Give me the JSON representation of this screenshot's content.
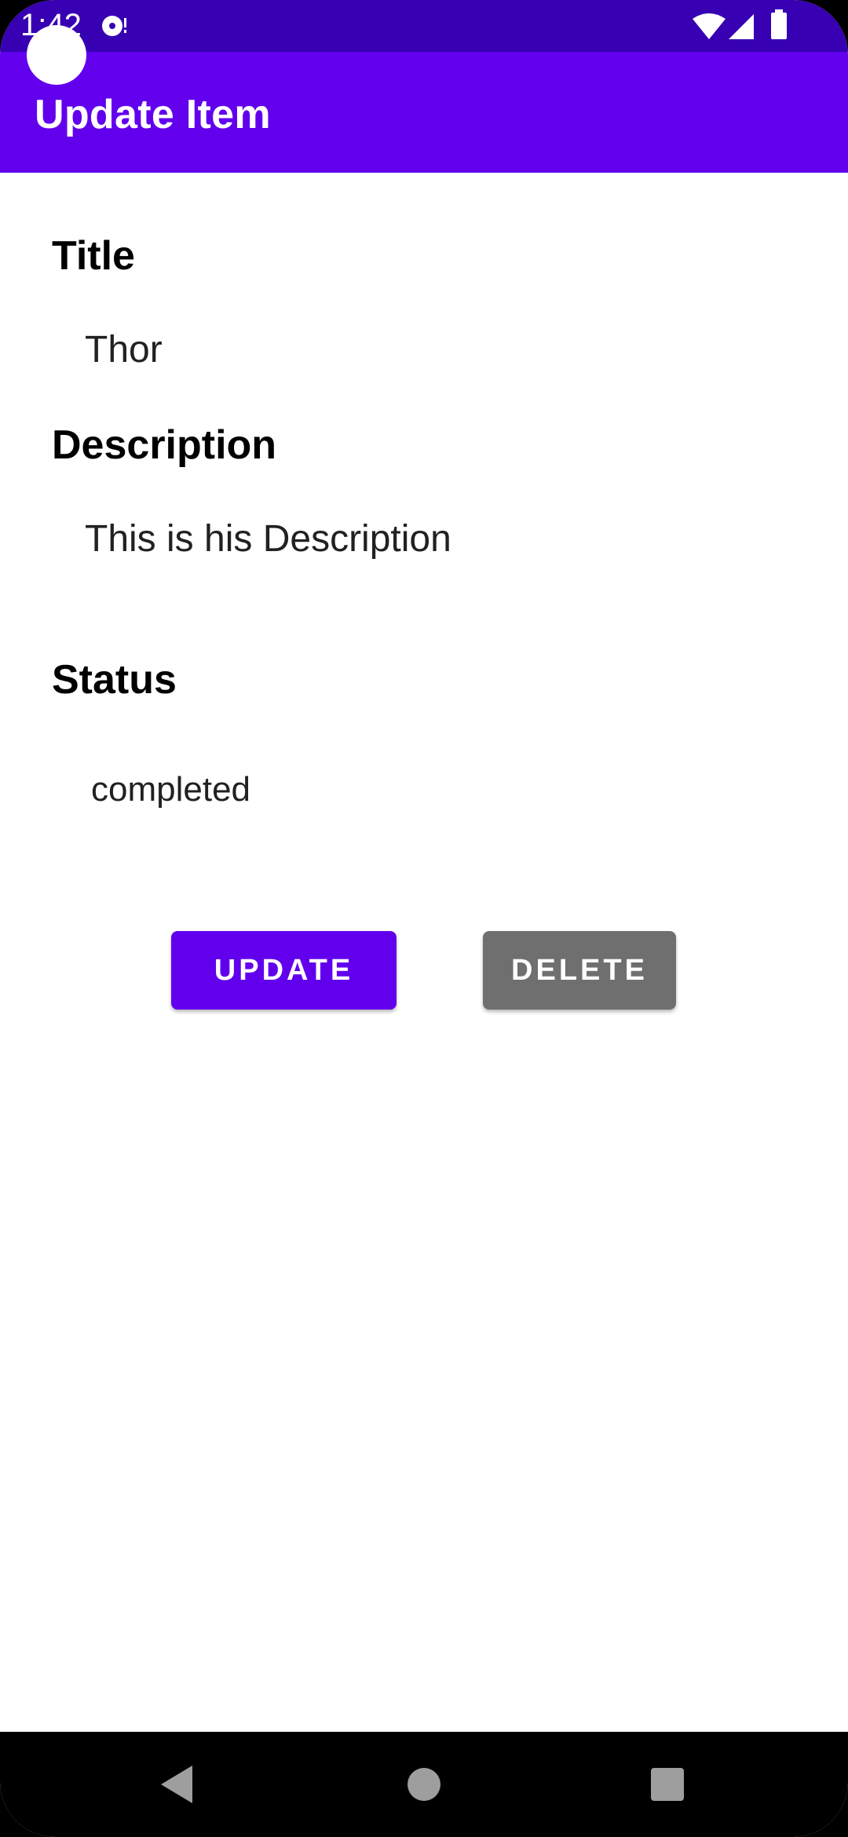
{
  "status_bar": {
    "time": "1:42",
    "icons": [
      "media-sync-icon",
      "wifi-icon",
      "signal-icon",
      "battery-icon"
    ],
    "background_color": "#3700b3"
  },
  "app_bar": {
    "title": "Update Item",
    "background_color": "#6200ee"
  },
  "fields": {
    "title": {
      "label": "Title",
      "value": "Thor"
    },
    "description": {
      "label": "Description",
      "value": "This is his Description"
    },
    "status": {
      "label": "Status",
      "value": "completed"
    }
  },
  "actions": {
    "update_label": "UPDATE",
    "delete_label": "DELETE",
    "update_color": "#6200ee",
    "delete_color": "#6f6f6f"
  },
  "nav_bar": {
    "buttons": [
      "back-icon",
      "home-icon",
      "recents-icon"
    ]
  }
}
